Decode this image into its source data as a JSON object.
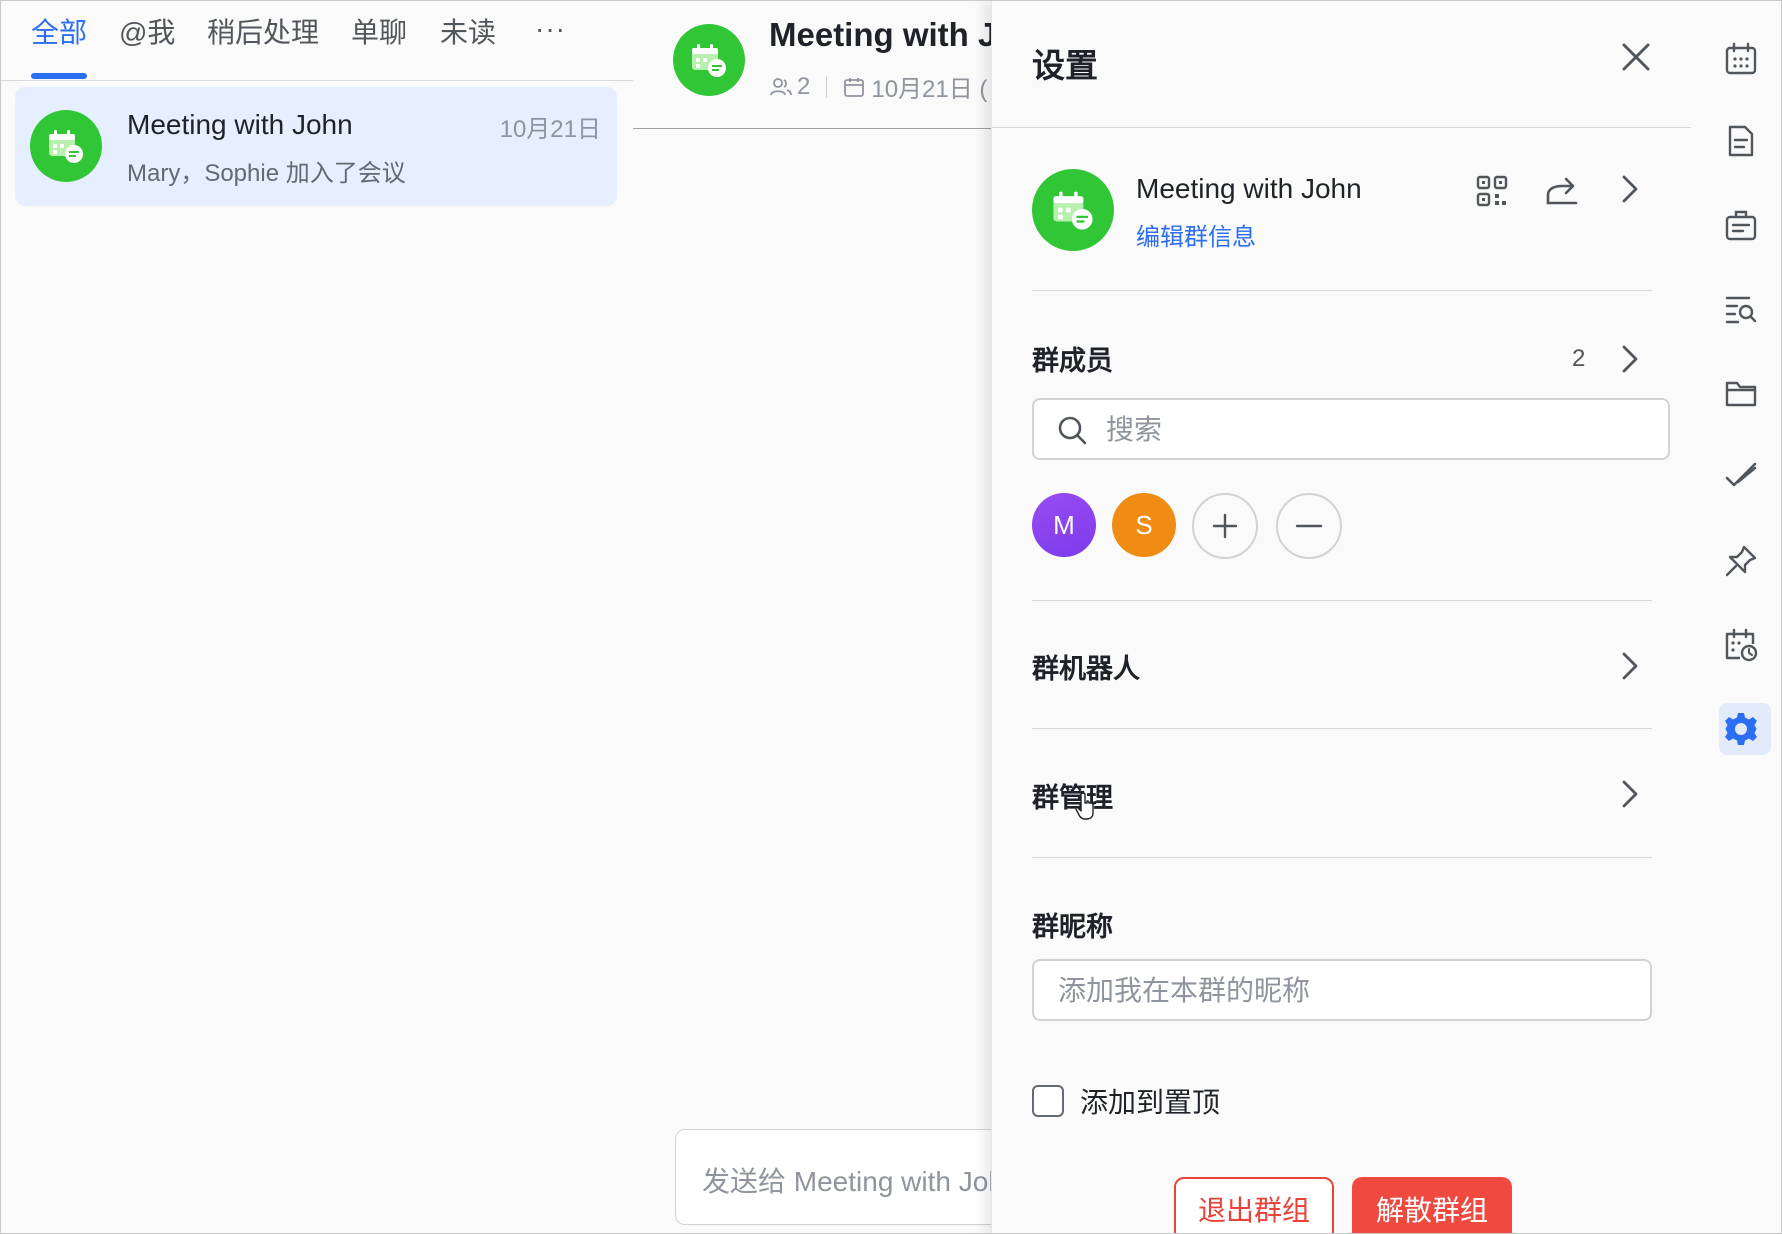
{
  "filter_tabs": {
    "items": [
      {
        "label": "全部",
        "active": true
      },
      {
        "label": "@我",
        "active": false
      },
      {
        "label": "稍后处理",
        "active": false
      },
      {
        "label": "单聊",
        "active": false
      },
      {
        "label": "未读",
        "active": false
      }
    ],
    "more_label": "···"
  },
  "conversation": {
    "title": "Meeting with John",
    "date": "10月21日",
    "preview": "Mary，Sophie 加入了会议",
    "icon": "calendar-chat-icon"
  },
  "chat": {
    "title": "Meeting with J",
    "member_count": "2",
    "date_text": "10月21日 (",
    "compose_placeholder": "发送给 Meeting with Joh"
  },
  "settings": {
    "title": "设置",
    "group_name": "Meeting with John",
    "edit_info_label": "编辑群信息",
    "members_label": "群成员",
    "members_count": "2",
    "search_placeholder": "搜索",
    "members": [
      {
        "initial": "M",
        "color": "#7c3aed"
      },
      {
        "initial": "S",
        "color": "#f08c13"
      }
    ],
    "bots_label": "群机器人",
    "manage_label": "群管理",
    "nickname_label": "群昵称",
    "nickname_placeholder": "添加我在本群的昵称",
    "pin_label": "添加到置顶",
    "pin_checked": false,
    "leave_label": "退出群组",
    "dissolve_label": "解散群组"
  },
  "rail": {
    "icons": [
      "calendar-grid-icon",
      "document-icon",
      "briefcase-icon",
      "search-list-icon",
      "folder-icon",
      "check-icon",
      "pin-icon",
      "calendar-clock-icon",
      "gear-icon"
    ],
    "active": "gear-icon"
  },
  "colors": {
    "accent": "#2b6ef2",
    "group_green": "#31c635",
    "danger": "#f04a40",
    "selected_bg": "#e5efff"
  }
}
